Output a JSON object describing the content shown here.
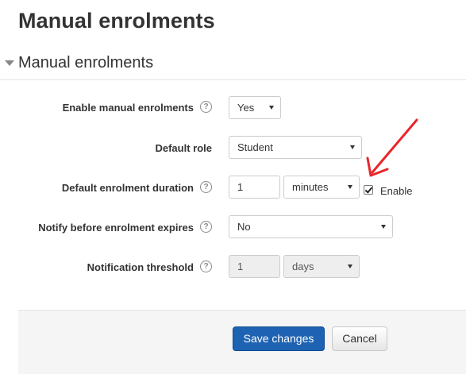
{
  "page": {
    "title": "Manual enrolments"
  },
  "section": {
    "title": "Manual enrolments"
  },
  "fields": {
    "enable_manual": {
      "label": "Enable manual enrolments",
      "value": "Yes"
    },
    "default_role": {
      "label": "Default role",
      "value": "Student"
    },
    "duration": {
      "label": "Default enrolment duration",
      "value": "1",
      "unit": "minutes",
      "enable_label": "Enable",
      "enabled": true
    },
    "notify": {
      "label": "Notify before enrolment expires",
      "value": "No"
    },
    "threshold": {
      "label": "Notification threshold",
      "value": "1",
      "unit": "days"
    }
  },
  "help_glyph": "?",
  "buttons": {
    "save": "Save changes",
    "cancel": "Cancel"
  },
  "colors": {
    "primary": "#1e63b3",
    "annotation_arrow": "#e8262b"
  }
}
